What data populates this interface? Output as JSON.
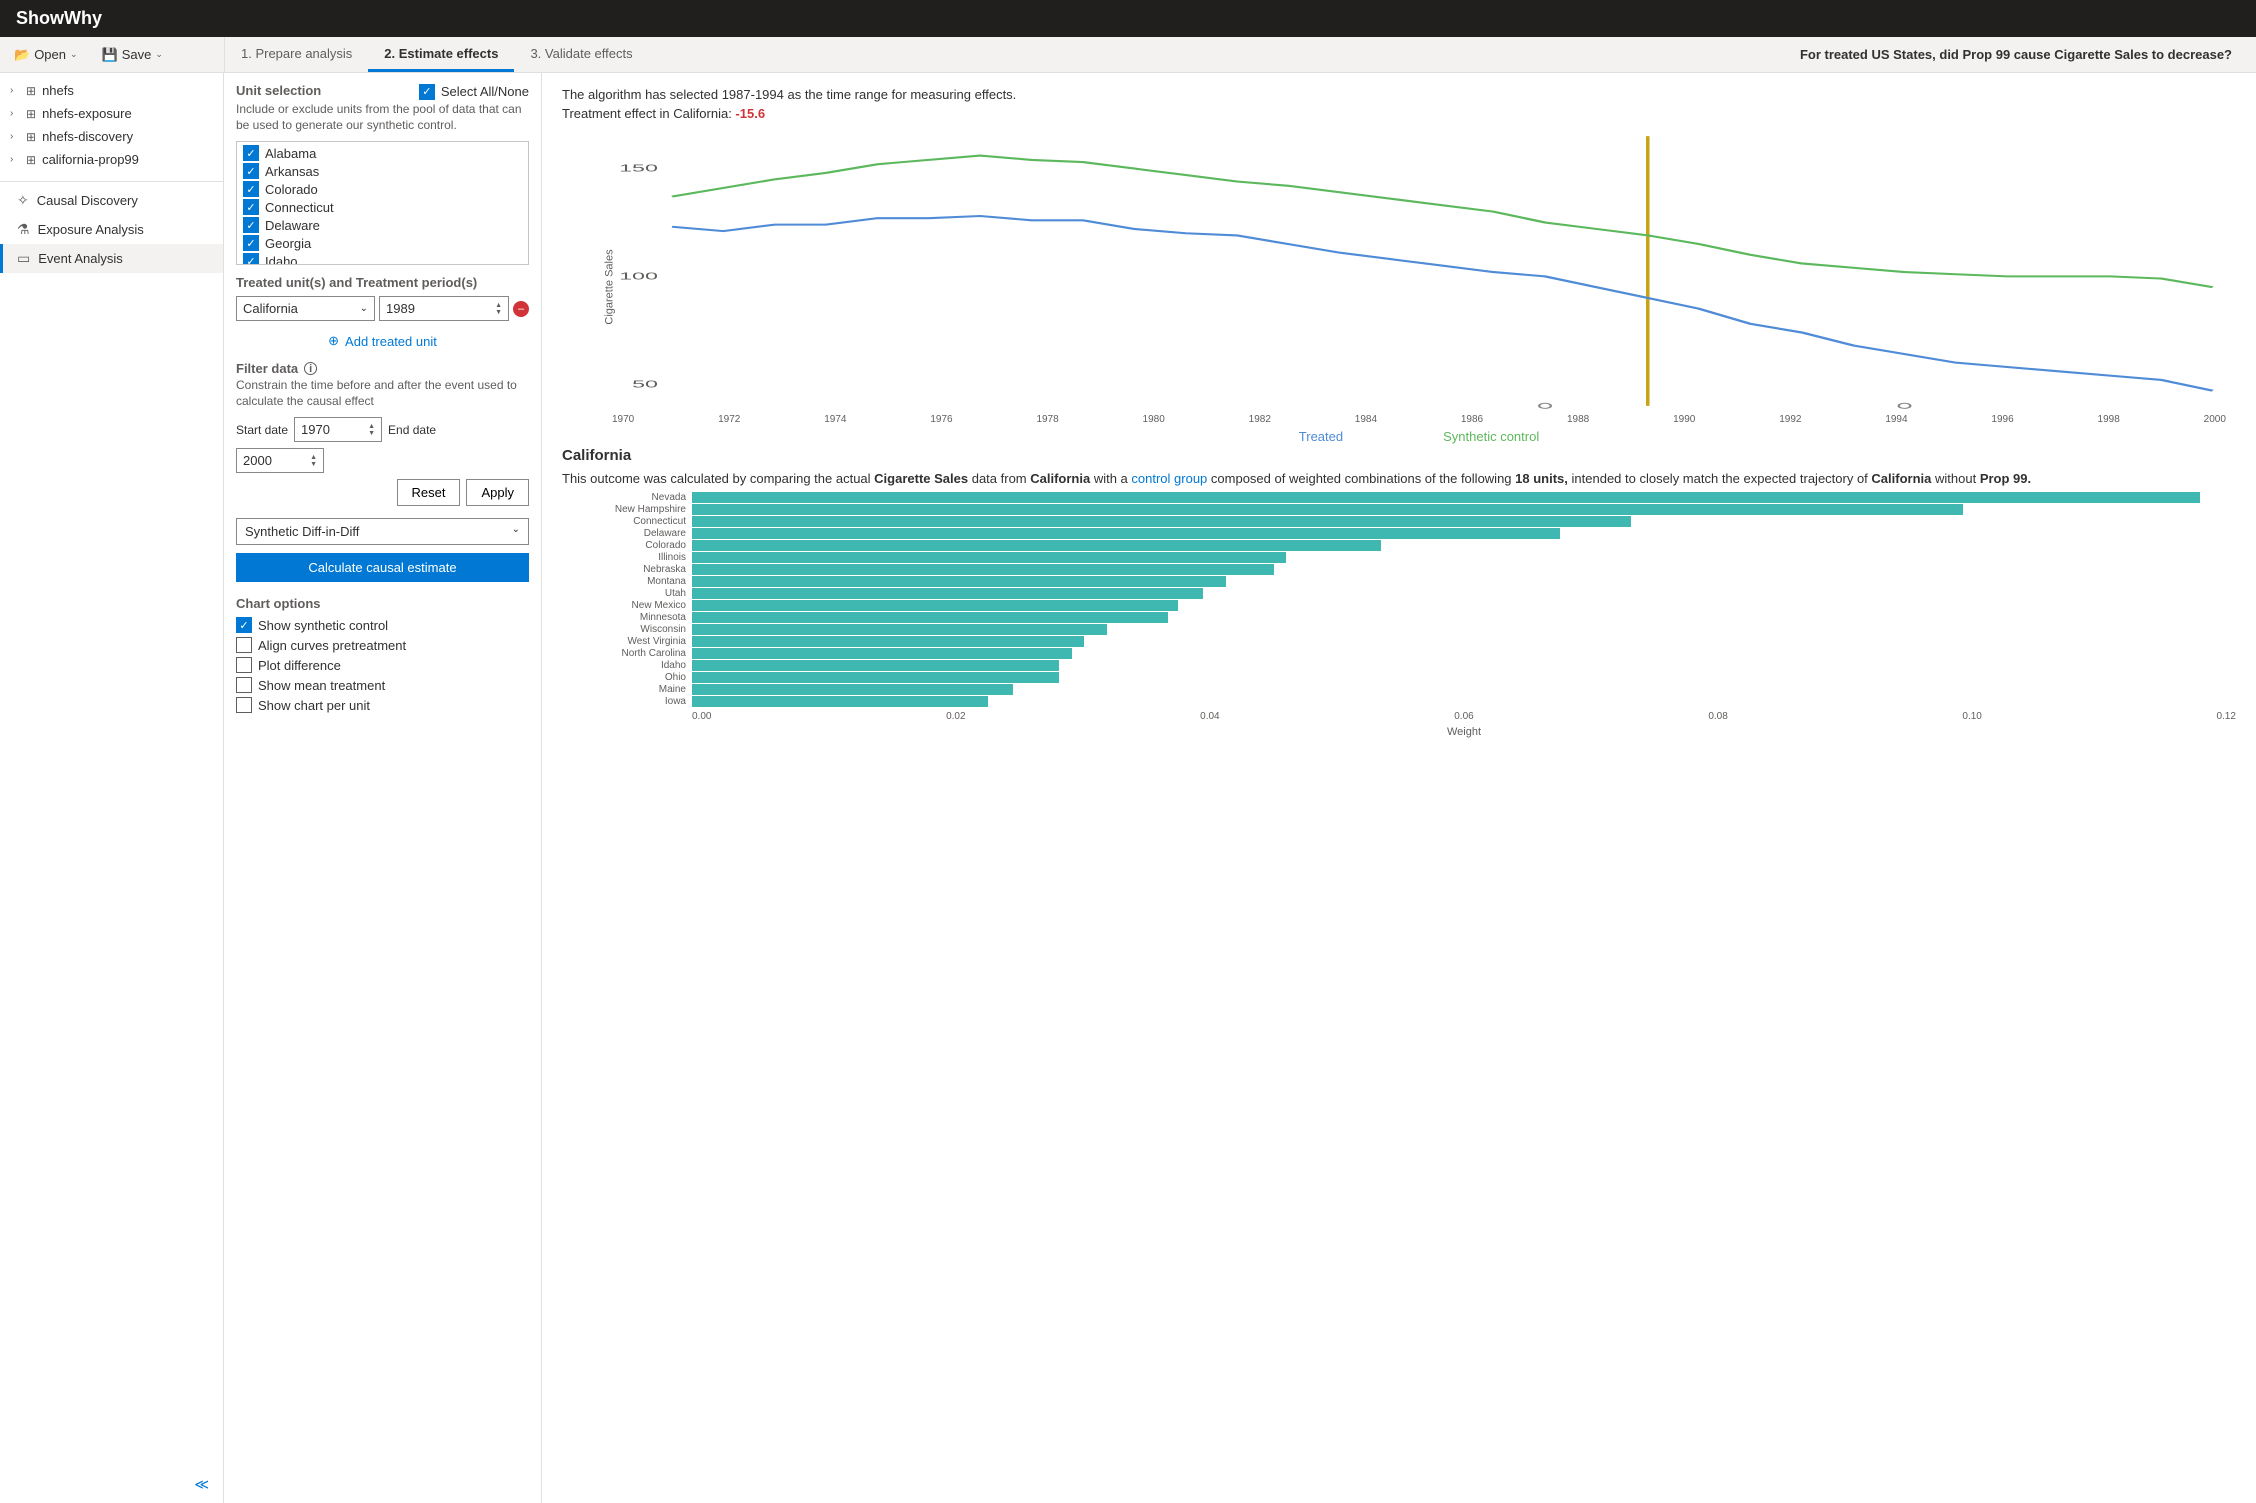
{
  "app": {
    "title": "ShowWhy"
  },
  "toolbar": {
    "open": "Open",
    "save": "Save"
  },
  "tabs": {
    "t1": "1. Prepare analysis",
    "t2": "2. Estimate effects",
    "t3": "3. Validate effects"
  },
  "question": "For treated US States, did Prop 99 cause Cigarette Sales to decrease?",
  "tree": [
    "nhefs",
    "nhefs-exposure",
    "nhefs-discovery",
    "california-prop99"
  ],
  "nav": {
    "discovery": "Causal Discovery",
    "exposure": "Exposure Analysis",
    "event": "Event Analysis"
  },
  "units": {
    "heading": "Unit selection",
    "desc": "Include or exclude units from the pool of data that can be used to generate our synthetic control.",
    "select_all": "Select All/None",
    "list": [
      "Alabama",
      "Arkansas",
      "Colorado",
      "Connecticut",
      "Delaware",
      "Georgia",
      "Idaho"
    ]
  },
  "treated": {
    "heading": "Treated unit(s) and Treatment period(s)",
    "unit": "California",
    "year": "1989",
    "add": "Add treated unit"
  },
  "filter": {
    "heading": "Filter data",
    "desc": "Constrain the time before and after the event used to calculate the causal effect",
    "start_label": "Start date",
    "start": "1970",
    "end_label": "End date",
    "end": "2000",
    "reset": "Reset",
    "apply": "Apply"
  },
  "method": "Synthetic Diff-in-Diff",
  "calc_btn": "Calculate causal estimate",
  "chart_opts": {
    "heading": "Chart options",
    "o1": "Show synthetic control",
    "o2": "Align curves pretreatment",
    "o3": "Plot difference",
    "o4": "Show mean treatment",
    "o5": "Show chart per unit"
  },
  "results": {
    "line1": "The algorithm has selected 1987-1994 as the time range for measuring effects.",
    "line2_pre": "Treatment effect in California: ",
    "effect": "-15.6",
    "legend_treated": "Treated",
    "legend_synth": "Synthetic control",
    "y_label": "Cigarette Sales",
    "subhead": "California",
    "desc_1": "This outcome was calculated by comparing the actual ",
    "desc_b1": "Cigarette Sales",
    "desc_2": " data from ",
    "desc_b2": "California",
    "desc_3": " with a ",
    "desc_link": "control group",
    "desc_4": " composed of weighted combinations of the following ",
    "desc_b3": "18 units,",
    "desc_5": " intended to closely match the expected trajectory of ",
    "desc_b4": "California",
    "desc_6": " without ",
    "desc_b5": "Prop 99.",
    "weight_axis_label": "Weight"
  },
  "chart_data": {
    "line_chart": {
      "type": "line",
      "title": "",
      "xlabel": "",
      "ylabel": "Cigarette Sales",
      "x": [
        1970,
        1971,
        1972,
        1973,
        1974,
        1975,
        1976,
        1977,
        1978,
        1979,
        1980,
        1981,
        1982,
        1983,
        1984,
        1985,
        1986,
        1987,
        1988,
        1989,
        1990,
        1991,
        1992,
        1993,
        1994,
        1995,
        1996,
        1997,
        1998,
        1999,
        2000
      ],
      "x_ticks": [
        1970,
        1972,
        1974,
        1976,
        1978,
        1980,
        1982,
        1984,
        1986,
        1988,
        1990,
        1992,
        1994,
        1996,
        1998,
        2000
      ],
      "y_ticks": [
        50,
        100,
        150
      ],
      "ylim": [
        40,
        165
      ],
      "treatment_year": 1989,
      "series": [
        {
          "name": "Treated",
          "color": "#4f8bd6",
          "values": [
            123,
            121,
            124,
            124,
            127,
            127,
            128,
            126,
            126,
            122,
            120,
            119,
            115,
            111,
            108,
            105,
            102,
            100,
            95,
            90,
            85,
            78,
            74,
            68,
            64,
            60,
            58,
            56,
            54,
            52,
            47
          ]
        },
        {
          "name": "Synthetic control",
          "color": "#5cb85c",
          "values": [
            137,
            141,
            145,
            148,
            152,
            154,
            156,
            154,
            153,
            150,
            147,
            144,
            142,
            139,
            136,
            133,
            130,
            125,
            122,
            119,
            115,
            110,
            106,
            104,
            102,
            101,
            100,
            100,
            100,
            99,
            95
          ]
        }
      ]
    },
    "weights_chart": {
      "type": "bar",
      "orientation": "horizontal",
      "xlabel": "Weight",
      "xlim": [
        0,
        0.13
      ],
      "x_ticks": [
        0.0,
        0.02,
        0.04,
        0.06,
        0.08,
        0.1,
        0.12
      ],
      "categories": [
        "Nevada",
        "New Hampshire",
        "Connecticut",
        "Delaware",
        "Colorado",
        "Illinois",
        "Nebraska",
        "Montana",
        "Utah",
        "New Mexico",
        "Minnesota",
        "Wisconsin",
        "West Virginia",
        "North Carolina",
        "Idaho",
        "Ohio",
        "Maine",
        "Iowa"
      ],
      "values": [
        0.127,
        0.107,
        0.079,
        0.073,
        0.058,
        0.05,
        0.049,
        0.045,
        0.043,
        0.041,
        0.04,
        0.035,
        0.033,
        0.032,
        0.031,
        0.031,
        0.027,
        0.025
      ]
    }
  }
}
